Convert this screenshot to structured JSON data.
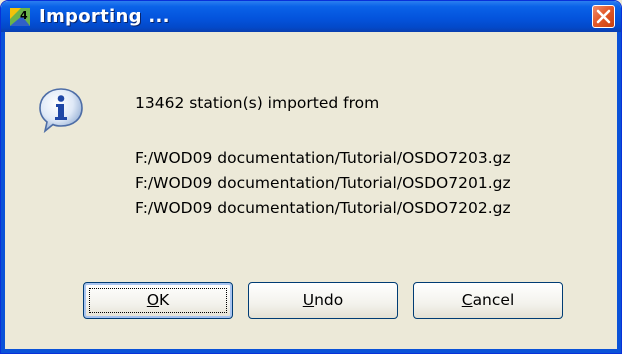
{
  "dialog": {
    "title": "Importing ...",
    "message_line1": "13462 station(s) imported from",
    "files": [
      "F:/WOD09 documentation/Tutorial/OSDO7203.gz",
      "F:/WOD09 documentation/Tutorial/OSDO7201.gz",
      "F:/WOD09 documentation/Tutorial/OSDO7202.gz"
    ],
    "icons": {
      "app": "ocean-data-view-icon",
      "message": "info-icon",
      "close": "close-icon"
    }
  },
  "buttons": {
    "ok": {
      "first": "O",
      "rest": "K"
    },
    "undo": {
      "first": "U",
      "rest": "ndo"
    },
    "cancel": {
      "first": "C",
      "rest": "ancel"
    }
  },
  "colors": {
    "titlebar": "#0454dd",
    "close": "#e35a2b",
    "dialog_bg": "#ece9d8"
  }
}
